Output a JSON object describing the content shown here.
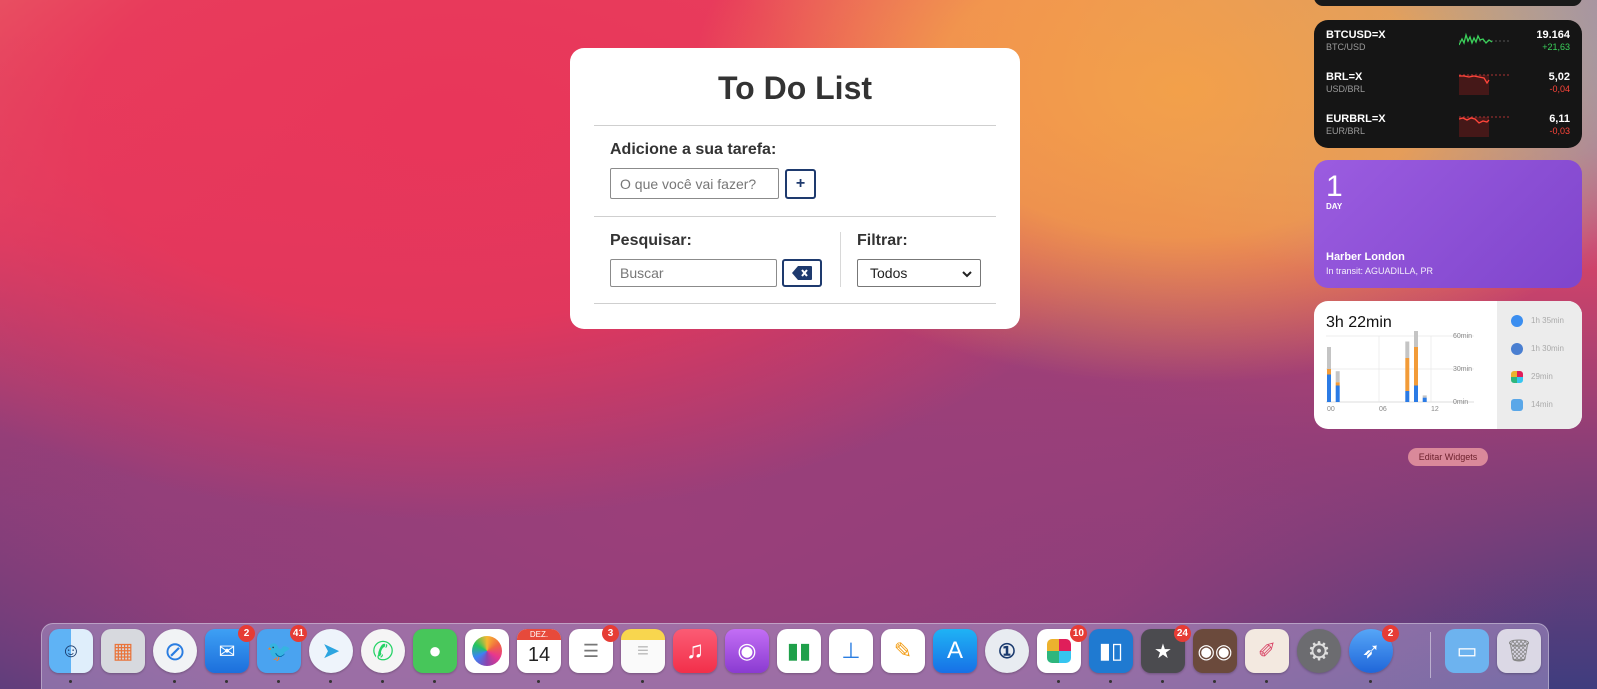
{
  "todo": {
    "title": "To Do List",
    "add_label": "Adicione a sua tarefa:",
    "add_placeholder": "O que você vai fazer?",
    "add_button": "+",
    "search_label": "Pesquisar:",
    "search_placeholder": "Buscar",
    "filter_label": "Filtrar:",
    "filter_selected": "Todos"
  },
  "stocks": [
    {
      "symbol": "BTCUSD=X",
      "name": "BTC/USD",
      "price": "19.164",
      "change": "+21,63",
      "trend": "up"
    },
    {
      "symbol": "BRL=X",
      "name": "USD/BRL",
      "price": "5,02",
      "change": "-0,04",
      "trend": "down"
    },
    {
      "symbol": "EURBRL=X",
      "name": "EUR/BRL",
      "price": "6,11",
      "change": "-0,03",
      "trend": "down"
    }
  ],
  "tracking": {
    "count": "1",
    "unit": "DAY",
    "carrier": "Harber London",
    "status": "In transit: AGUADILLA, PR"
  },
  "screen_time": {
    "total": "3h 22min",
    "y_labels": [
      "60min",
      "30min",
      "0min"
    ],
    "x_labels": [
      "00",
      "06",
      "12"
    ],
    "apps": [
      {
        "icon": "safari-icon",
        "time": "1h 35min"
      },
      {
        "icon": "safari-blue-icon",
        "time": "1h 30min"
      },
      {
        "icon": "slack-icon",
        "time": "29min"
      },
      {
        "icon": "finder-icon",
        "time": "14min"
      }
    ],
    "chart_data": {
      "type": "bar",
      "series": [
        {
          "hour": 0,
          "blue": 25,
          "orange": 5,
          "gray": 20
        },
        {
          "hour": 1,
          "blue": 15,
          "orange": 3,
          "gray": 10
        },
        {
          "hour": 9,
          "blue": 10,
          "orange": 30,
          "gray": 15
        },
        {
          "hour": 10,
          "blue": 15,
          "orange": 35,
          "gray": 20
        },
        {
          "hour": 11,
          "blue": 4,
          "orange": 0,
          "gray": 2
        }
      ]
    }
  },
  "edit_widgets": "Editar Widgets",
  "dock": {
    "calendar_month": "DEZ.",
    "calendar_day": "14",
    "apps": [
      {
        "name": "finder",
        "badge": ""
      },
      {
        "name": "launchpad",
        "badge": ""
      },
      {
        "name": "safari",
        "badge": ""
      },
      {
        "name": "mail",
        "badge": "2"
      },
      {
        "name": "tweetbot",
        "badge": "41"
      },
      {
        "name": "telegram",
        "badge": ""
      },
      {
        "name": "whatsapp",
        "badge": ""
      },
      {
        "name": "messages",
        "badge": ""
      },
      {
        "name": "photos",
        "badge": ""
      },
      {
        "name": "calendar",
        "badge": ""
      },
      {
        "name": "reminders",
        "badge": "3"
      },
      {
        "name": "notes",
        "badge": ""
      },
      {
        "name": "music",
        "badge": ""
      },
      {
        "name": "podcasts",
        "badge": ""
      },
      {
        "name": "numbers",
        "badge": ""
      },
      {
        "name": "keynote",
        "badge": ""
      },
      {
        "name": "pages",
        "badge": ""
      },
      {
        "name": "app-store",
        "badge": ""
      },
      {
        "name": "1password",
        "badge": ""
      },
      {
        "name": "slack",
        "badge": "10"
      },
      {
        "name": "trello",
        "badge": ""
      },
      {
        "name": "reeder",
        "badge": "24"
      },
      {
        "name": "tweetbot-2",
        "badge": ""
      },
      {
        "name": "pixelmator",
        "badge": ""
      },
      {
        "name": "system-preferences",
        "badge": ""
      },
      {
        "name": "spark",
        "badge": "2"
      },
      {
        "name": "downloads-folder",
        "badge": ""
      },
      {
        "name": "trash",
        "badge": ""
      }
    ]
  }
}
